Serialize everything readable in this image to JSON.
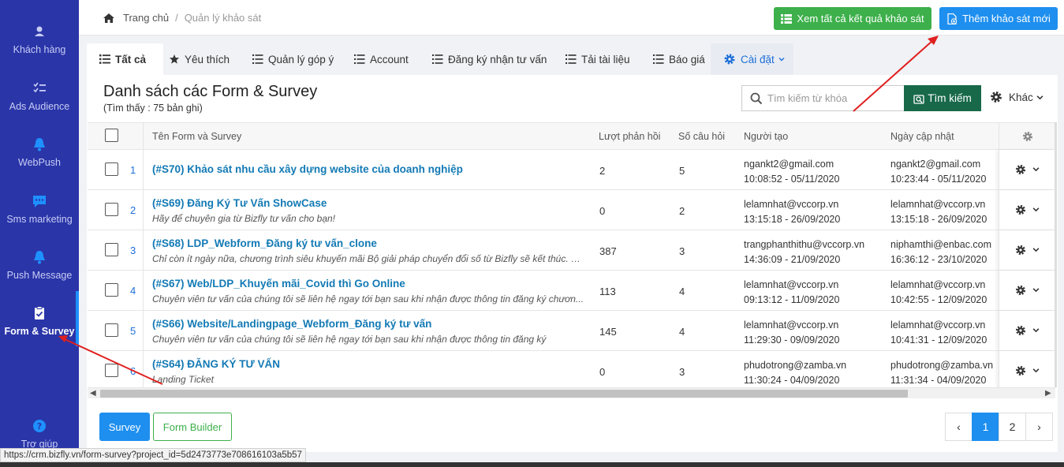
{
  "sidebar": {
    "items": [
      {
        "label": "Khách hàng",
        "icon": "user-icon"
      },
      {
        "label": "Ads Audience",
        "icon": "list-check-icon"
      },
      {
        "label": "WebPush",
        "icon": "bell-icon"
      },
      {
        "label": "Sms marketing",
        "icon": "chat-icon"
      },
      {
        "label": "Push Message",
        "icon": "bell-icon"
      },
      {
        "label": "Form & Survey",
        "icon": "clipboard-check-icon"
      },
      {
        "label": "Trợ giúp",
        "icon": "help-icon"
      }
    ]
  },
  "breadcrumb": {
    "home": "Trang chủ",
    "current": "Quản lý khảo sát"
  },
  "header": {
    "view_all_label": "Xem tất cả kết quả khảo sát",
    "add_new_label": "Thêm khảo sát mới"
  },
  "tabs": [
    {
      "label": "Tất cả",
      "icon": "list-icon"
    },
    {
      "label": "Yêu thích",
      "icon": "star-icon"
    },
    {
      "label": "Quản lý góp ý",
      "icon": "list-icon"
    },
    {
      "label": "Account",
      "icon": "list-icon"
    },
    {
      "label": "Đăng ký nhận tư vấn",
      "icon": "list-icon"
    },
    {
      "label": "Tải tài liệu",
      "icon": "list-icon"
    },
    {
      "label": "Báo giá",
      "icon": "list-icon"
    },
    {
      "label": "Cài đặt",
      "icon": "gear-icon"
    }
  ],
  "panel": {
    "title": "Danh sách các Form & Survey",
    "count_text": "(Tìm thấy : 75 bản ghi)",
    "search_placeholder": "Tìm kiếm từ khóa",
    "search_button": "Tìm kiếm",
    "other_label": "Khác"
  },
  "table": {
    "headers": {
      "name": "Tên Form và Survey",
      "responses": "Lượt phản hồi",
      "questions": "Số câu hỏi",
      "creator": "Người tạo",
      "updated": "Ngày cập nhật"
    },
    "rows": [
      {
        "no": "1",
        "title": "(#S70) Khảo sát nhu cầu xây dựng website của doanh nghiệp",
        "desc": "",
        "responses": "2",
        "questions": "5",
        "creator": "ngankt2@gmail.com",
        "created_at": "10:08:52 - 05/11/2020",
        "updater": "ngankt2@gmail.com",
        "updated_at": "10:23:44 - 05/11/2020"
      },
      {
        "no": "2",
        "title": "(#S69) Đăng Ký Tư Vấn ShowCase",
        "desc": "Hãy để chuyên gia từ Bizfly tư vấn cho bạn!",
        "responses": "0",
        "questions": "2",
        "creator": "lelamnhat@vccorp.vn",
        "created_at": "13:15:18 - 26/09/2020",
        "updater": "lelamnhat@vccorp.vn",
        "updated_at": "13:15:18 - 26/09/2020"
      },
      {
        "no": "3",
        "title": "(#S68) LDP_Webform_Đăng ký tư vấn_clone",
        "desc": "Chỉ còn ít ngày nữa, chương trình siêu khuyến mãi Bộ giải pháp chuyển đổi số từ Bizfly sẽ kết thúc. Nh...",
        "responses": "387",
        "questions": "3",
        "creator": "trangphanthithu@vccorp.vn",
        "created_at": "14:36:09 - 21/09/2020",
        "updater": "niphamthi@enbac.com",
        "updated_at": "16:36:12 - 23/10/2020"
      },
      {
        "no": "4",
        "title": "(#S67) Web/LDP_Khuyến mãi_Covid thì Go Online",
        "desc": "Chuyên viên tư vấn của chúng tôi sẽ liên hệ ngay tới bạn sau khi nhận được thông tin đăng ký chươn...",
        "responses": "113",
        "questions": "4",
        "creator": "lelamnhat@vccorp.vn",
        "created_at": "09:13:12 - 11/09/2020",
        "updater": "lelamnhat@vccorp.vn",
        "updated_at": "10:42:55 - 12/09/2020"
      },
      {
        "no": "5",
        "title": "(#S66) Website/Landingpage_Webform_Đăng ký tư vấn",
        "desc": "Chuyên viên tư vấn của chúng tôi sẽ liên hệ ngay tới bạn sau khi nhận được thông tin đăng ký",
        "responses": "145",
        "questions": "4",
        "creator": "lelamnhat@vccorp.vn",
        "created_at": "11:29:30 - 09/09/2020",
        "updater": "lelamnhat@vccorp.vn",
        "updated_at": "10:41:31 - 12/09/2020"
      },
      {
        "no": "6",
        "title": "(#S64) ĐĂNG KÝ TƯ VẤN",
        "desc": "Landing Ticket",
        "responses": "0",
        "questions": "3",
        "creator": "phudotrong@zamba.vn",
        "created_at": "11:30:24 - 04/09/2020",
        "updater": "phudotrong@zamba.vn",
        "updated_at": "11:31:34 - 04/09/2020"
      }
    ]
  },
  "footer": {
    "survey_button": "Survey",
    "form_builder_button": "Form Builder",
    "pages": [
      "‹",
      "1",
      "2",
      "›"
    ]
  },
  "status_url": "https://crm.bizfly.vn/form-survey?project_id=5d2473773e708616103a5b57",
  "colors": {
    "sidebar_bg": "#2a35a8",
    "primary": "#1e8fef",
    "success": "#3db04b",
    "search_button": "#17694a",
    "link": "#137ab5",
    "annotation": "#e02020"
  }
}
